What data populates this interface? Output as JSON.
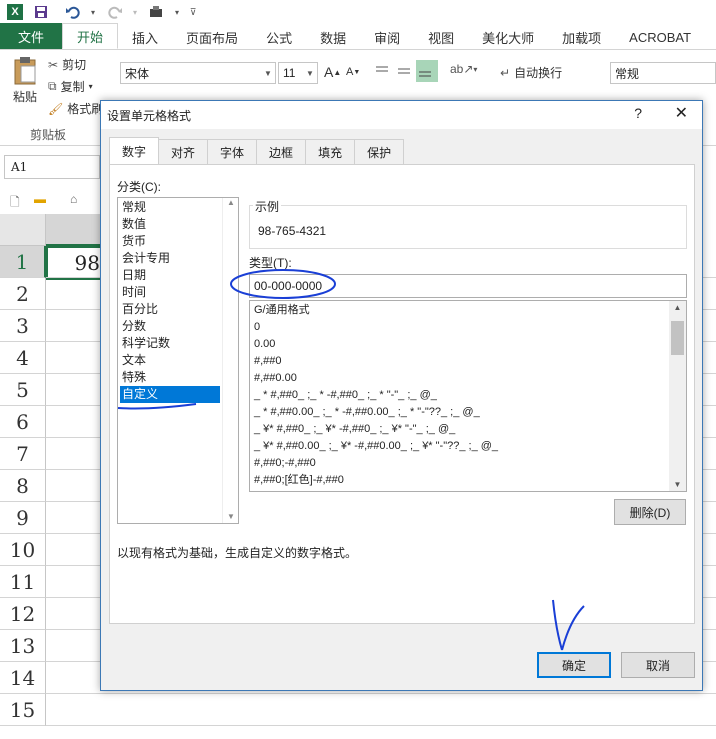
{
  "quick_access": {
    "excel_logo": "X",
    "icons": [
      "save-icon",
      "undo-icon",
      "redo-icon",
      "customize-icon"
    ]
  },
  "ribbon": {
    "tabs": [
      "文件",
      "开始",
      "插入",
      "页面布局",
      "公式",
      "数据",
      "审阅",
      "视图",
      "美化大师",
      "加载项",
      "ACROBAT"
    ],
    "active_tab": "开始",
    "paste_label": "粘贴",
    "cut_label": "剪切",
    "copy_label": "复制",
    "format_painter_label": "格式刷",
    "clipboard_group_label": "剪贴板",
    "font_name": "宋体",
    "font_size": "11",
    "wrap_text_label": "自动换行",
    "number_format": "常规"
  },
  "name_box": "A1",
  "sheet": {
    "rows": [
      "1",
      "2",
      "3",
      "4",
      "5",
      "6",
      "7",
      "8",
      "9",
      "10",
      "11",
      "12",
      "13",
      "14",
      "15"
    ],
    "a1_value": "98"
  },
  "dialog": {
    "title": "设置单元格格式",
    "help": "?",
    "close": "✕",
    "tabs": [
      "数字",
      "对齐",
      "字体",
      "边框",
      "填充",
      "保护"
    ],
    "active_tab": "数字",
    "category_label": "分类(C):",
    "categories": [
      "常规",
      "数值",
      "货币",
      "会计专用",
      "日期",
      "时间",
      "百分比",
      "分数",
      "科学记数",
      "文本",
      "特殊",
      "自定义"
    ],
    "selected_category": "自定义",
    "sample_label": "示例",
    "sample_value": "98-765-4321",
    "type_label": "类型(T):",
    "type_value": "00-000-0000",
    "format_list": [
      "G/通用格式",
      "0",
      "0.00",
      "#,##0",
      "#,##0.00",
      "_ * #,##0_ ;_ * -#,##0_ ;_ * \"-\"_ ;_ @_",
      "_ * #,##0.00_ ;_ * -#,##0.00_ ;_ * \"-\"??_ ;_ @_",
      "_ ¥* #,##0_ ;_ ¥* -#,##0_ ;_ ¥* \"-\"_ ;_ @_",
      "_ ¥* #,##0.00_ ;_ ¥* -#,##0.00_ ;_ ¥* \"-\"??_ ;_ @_",
      "#,##0;-#,##0",
      "#,##0;[红色]-#,##0"
    ],
    "delete_label": "删除(D)",
    "description": "以现有格式为基础，生成自定义的数字格式。",
    "ok_label": "确定",
    "cancel_label": "取消"
  },
  "colors": {
    "excel_green": "#217346",
    "selection_blue": "#0078d7",
    "annotation_blue": "#1a3fd6"
  }
}
